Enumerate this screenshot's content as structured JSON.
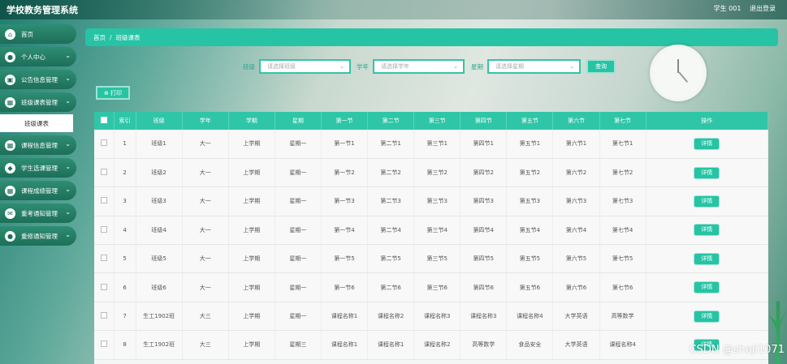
{
  "header": {
    "app_title": "学校教务管理系统",
    "user": "学生 001",
    "logout": "退出登录"
  },
  "sidebar": {
    "items": [
      {
        "label": "首页",
        "icon": "home-icon",
        "glyph": "⌂",
        "has_chevron": false
      },
      {
        "label": "个人中心",
        "icon": "user-icon",
        "glyph": "●",
        "has_chevron": true
      },
      {
        "label": "公告信息管理",
        "icon": "notice-icon",
        "glyph": "▣",
        "has_chevron": true
      },
      {
        "label": "班级课表管理",
        "icon": "grid-icon",
        "glyph": "▦",
        "has_chevron": true,
        "expanded": true,
        "children": [
          {
            "label": "班级课表",
            "active": true
          }
        ]
      },
      {
        "label": "课程信息管理",
        "icon": "grid-icon",
        "glyph": "▦",
        "has_chevron": true
      },
      {
        "label": "学生选课管理",
        "icon": "cap-icon",
        "glyph": "◆",
        "has_chevron": true
      },
      {
        "label": "课程成绩管理",
        "icon": "grid-icon",
        "glyph": "▦",
        "has_chevron": true
      },
      {
        "label": "重考通知管理",
        "icon": "mail-icon",
        "glyph": "✉",
        "has_chevron": true
      },
      {
        "label": "重修通知管理",
        "icon": "user-icon",
        "glyph": "●",
        "has_chevron": true
      }
    ]
  },
  "breadcrumb": {
    "home": "首页",
    "separator": "/",
    "current": "班级课表"
  },
  "filters": {
    "class_label": "班级",
    "class_placeholder": "请选择班级",
    "year_label": "学年",
    "year_placeholder": "请选择学年",
    "weekday_label": "星期",
    "weekday_placeholder": "请选择星期",
    "search_button": "查询"
  },
  "toolbar": {
    "print_button": "⊕ 打印"
  },
  "table": {
    "columns": [
      "索引",
      "班级",
      "学年",
      "学期",
      "星期",
      "第一节",
      "第二节",
      "第三节",
      "第四节",
      "第五节",
      "第六节",
      "第七节",
      "操作"
    ],
    "detail_button": "详情",
    "rows": [
      [
        "1",
        "班级1",
        "大一",
        "上学期",
        "星期一",
        "第一节1",
        "第二节1",
        "第三节1",
        "第四节1",
        "第五节1",
        "第六节1",
        "第七节1"
      ],
      [
        "2",
        "班级2",
        "大一",
        "上学期",
        "星期一",
        "第一节2",
        "第二节2",
        "第三节2",
        "第四节2",
        "第五节2",
        "第六节2",
        "第七节2"
      ],
      [
        "3",
        "班级3",
        "大一",
        "上学期",
        "星期一",
        "第一节3",
        "第二节3",
        "第三节3",
        "第四节3",
        "第五节3",
        "第六节3",
        "第七节3"
      ],
      [
        "4",
        "班级4",
        "大一",
        "上学期",
        "星期一",
        "第一节4",
        "第二节4",
        "第三节4",
        "第四节4",
        "第五节4",
        "第六节4",
        "第七节4"
      ],
      [
        "5",
        "班级5",
        "大一",
        "上学期",
        "星期一",
        "第一节5",
        "第二节5",
        "第三节5",
        "第四节5",
        "第五节5",
        "第六节5",
        "第七节5"
      ],
      [
        "6",
        "班级6",
        "大一",
        "上学期",
        "星期一",
        "第一节6",
        "第二节6",
        "第三节6",
        "第四节6",
        "第五节6",
        "第六节6",
        "第七节6"
      ],
      [
        "7",
        "生工1902班",
        "大三",
        "上学期",
        "星期一",
        "课程名称1",
        "课程名称2",
        "课程名称3",
        "课程名称3",
        "课程名称4",
        "大学英语",
        "高等数学"
      ],
      [
        "8",
        "生工1902班",
        "大三",
        "上学期",
        "星期三",
        "课程名称1",
        "课程名称1",
        "课程名称2",
        "高等数学",
        "食品安全",
        "大学英语",
        "课程名称4"
      ]
    ]
  },
  "watermark": "CSDN @sheji1071",
  "colors": {
    "accent": "#26c4a4",
    "sidebar": "#1d6f58",
    "table_header": "#2fc6a7"
  }
}
